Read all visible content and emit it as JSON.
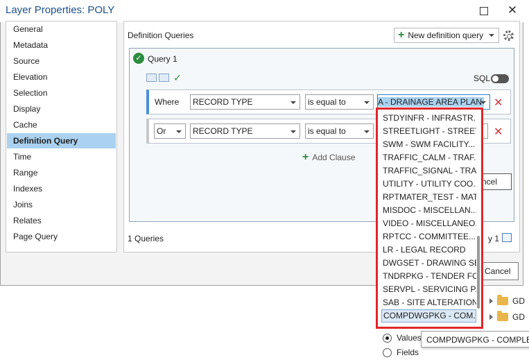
{
  "window": {
    "title": "Layer Properties: POLY"
  },
  "nav": {
    "items": [
      {
        "label": "General"
      },
      {
        "label": "Metadata"
      },
      {
        "label": "Source"
      },
      {
        "label": "Elevation"
      },
      {
        "label": "Selection"
      },
      {
        "label": "Display"
      },
      {
        "label": "Cache"
      },
      {
        "label": "Definition Query"
      },
      {
        "label": "Time"
      },
      {
        "label": "Range"
      },
      {
        "label": "Indexes"
      },
      {
        "label": "Joins"
      },
      {
        "label": "Relates"
      },
      {
        "label": "Page Query"
      }
    ],
    "selected": "Definition Query"
  },
  "panel": {
    "title": "Definition Queries",
    "new_query_label": "New definition query",
    "query_name": "Query 1",
    "sql_label": "SQL",
    "clauses": [
      {
        "connector": "Where",
        "field": "RECORD TYPE",
        "operator": "is equal to",
        "value": "A - DRAINAGE AREA PLAN"
      },
      {
        "connector": "Or",
        "field": "RECORD TYPE",
        "operator": "is equal to",
        "value": ""
      }
    ],
    "add_clause_label": "Add Clause",
    "cancel_partial": "ncel",
    "footer_count": "1 Queries",
    "footer_right": "y 1"
  },
  "dialog_buttons": {
    "cancel_label": "Cancel"
  },
  "dropdown": {
    "items": [
      "STDYINFR - INFRASTR...",
      "STREETLIGHT - STREET...",
      "SWM - SWM FACILITY...",
      "TRAFFIC_CALM - TRAF...",
      "TRAFFIC_SIGNAL - TRA...",
      "UTILITY - UTILITY COO...",
      "RPTMATER_TEST - MAT...",
      "MISDOC - MISCELLAN...",
      "VIDEO - MISCELLANEO...",
      "RPTCC - COMMITTEE...",
      "LR - LEGAL RECORD",
      "DWGSET - DRAWING SET",
      "TNDRPKG - TENDER FO...",
      "SERVPL - SERVICING P...",
      "SAB - SITE ALTERATION",
      "COMPDWGPKG - COM..."
    ],
    "highlighted": "COMPDWGPKG - COM..."
  },
  "tooltip": {
    "text": "COMPDWGPKG - COMPLET"
  },
  "background": {
    "tree_items": [
      "GD",
      "GD"
    ],
    "radio_values": "Values",
    "radio_fields": "Fields"
  }
}
